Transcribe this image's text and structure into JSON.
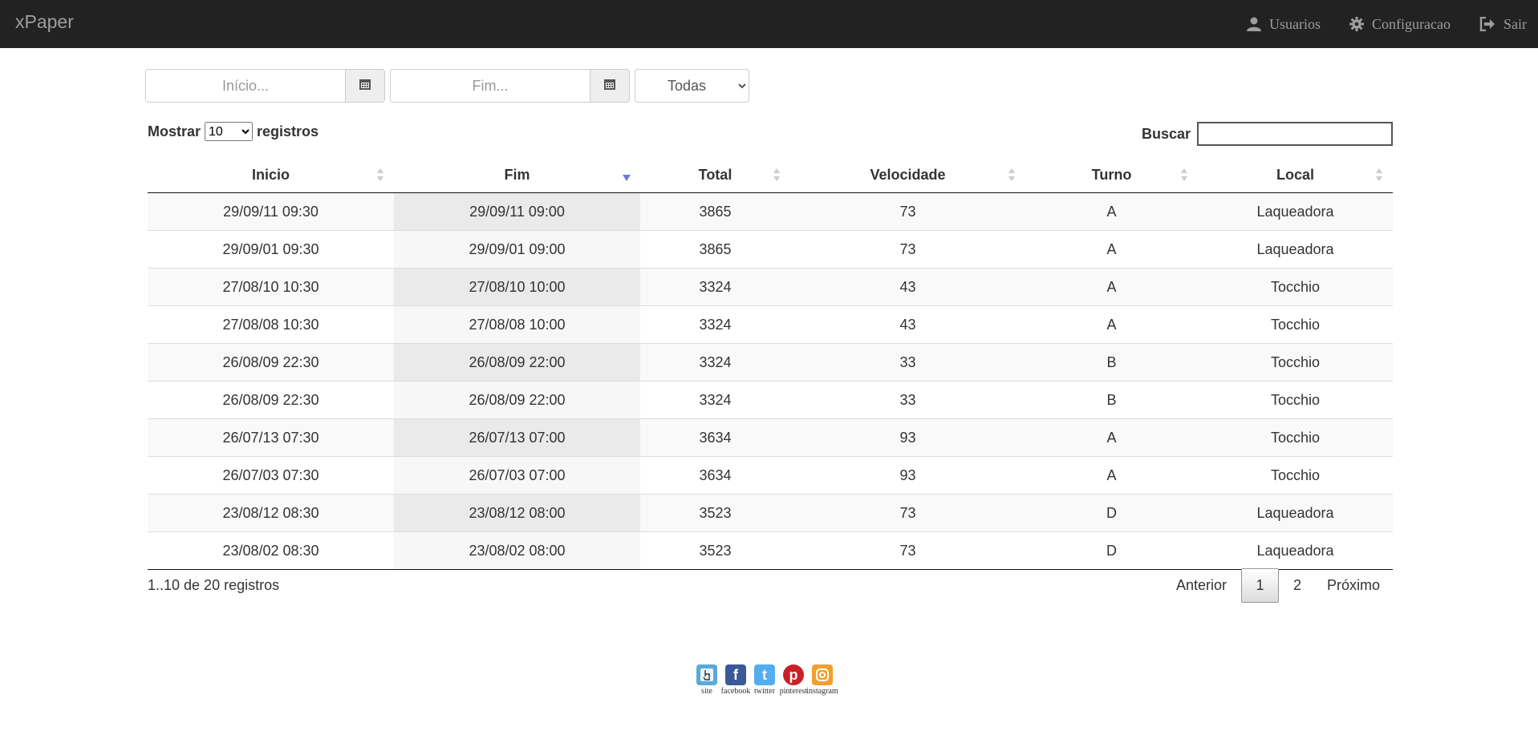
{
  "app": {
    "brand": "xPaper"
  },
  "nav": {
    "users": {
      "label": "Usuarios",
      "icon": "user-icon"
    },
    "config": {
      "label": "Configuracao",
      "icon": "gear-icon"
    },
    "logout": {
      "label": "Sair",
      "icon": "logout-icon"
    }
  },
  "filters": {
    "start_placeholder": "Início...",
    "end_placeholder": "Fim...",
    "scope_selected": "Todas"
  },
  "table_controls": {
    "show_label": "Mostrar",
    "page_length": "10",
    "records_label": "registros",
    "search_label": "Buscar",
    "search_value": ""
  },
  "table": {
    "headers": [
      "Inicio",
      "Fim",
      "Total",
      "Velocidade",
      "Turno",
      "Local"
    ],
    "sorted_column": "Fim",
    "rows": [
      [
        "29/09/11 09:30",
        "29/09/11 09:00",
        "3865",
        "73",
        "A",
        "Laqueadora"
      ],
      [
        "29/09/01 09:30",
        "29/09/01 09:00",
        "3865",
        "73",
        "A",
        "Laqueadora"
      ],
      [
        "27/08/10 10:30",
        "27/08/10 10:00",
        "3324",
        "43",
        "A",
        "Tocchio"
      ],
      [
        "27/08/08 10:30",
        "27/08/08 10:00",
        "3324",
        "43",
        "A",
        "Tocchio"
      ],
      [
        "26/08/09 22:30",
        "26/08/09 22:00",
        "3324",
        "33",
        "B",
        "Tocchio"
      ],
      [
        "26/08/09 22:30",
        "26/08/09 22:00",
        "3324",
        "33",
        "B",
        "Tocchio"
      ],
      [
        "26/07/13 07:30",
        "26/07/13 07:00",
        "3634",
        "93",
        "A",
        "Tocchio"
      ],
      [
        "26/07/03 07:30",
        "26/07/03 07:00",
        "3634",
        "93",
        "A",
        "Tocchio"
      ],
      [
        "23/08/12 08:30",
        "23/08/12 08:00",
        "3523",
        "73",
        "D",
        "Laqueadora"
      ],
      [
        "23/08/02 08:30",
        "23/08/02 08:00",
        "3523",
        "73",
        "D",
        "Laqueadora"
      ]
    ]
  },
  "pagination": {
    "info": "1..10 de 20 registros",
    "prev": "Anterior",
    "pages": [
      "1",
      "2"
    ],
    "current": "1",
    "next": "Próximo"
  },
  "social": [
    {
      "label": "site",
      "icon": "hand-pointer-icon",
      "color": "#5aa9d6"
    },
    {
      "label": "facebook",
      "icon": "facebook-icon",
      "color": "#3b5998"
    },
    {
      "label": "twitter",
      "icon": "twitter-icon",
      "color": "#55acee"
    },
    {
      "label": "pinterest",
      "icon": "pinterest-icon",
      "color": "#cb2027"
    },
    {
      "label": "instagram",
      "icon": "instagram-icon",
      "color": "#f0a030"
    }
  ],
  "colors": {
    "navbar": "#222222",
    "nav_text": "#9d9d9d",
    "sort_active": "#6c7bd8"
  }
}
